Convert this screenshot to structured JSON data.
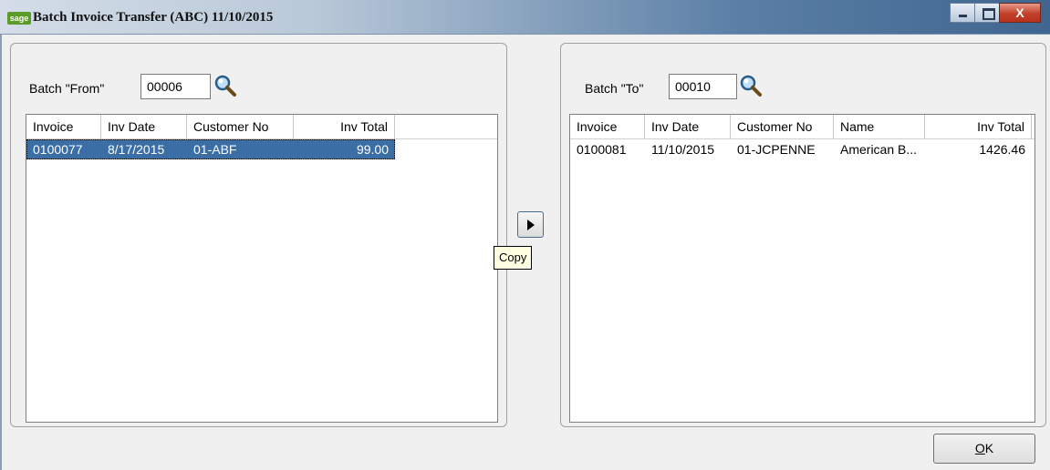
{
  "window": {
    "logo_text": "sage",
    "title": "Batch Invoice Transfer (ABC) 11/10/2015",
    "close_glyph": "X"
  },
  "left_panel": {
    "batch_label": "Batch \"From\"",
    "batch_value": "00006",
    "lookup_icon": "magnifier-icon",
    "columns": [
      "Invoice",
      "Inv Date",
      "Customer No",
      "Inv Total"
    ],
    "rows": [
      {
        "invoice": "0100077",
        "inv_date": "8/17/2015",
        "customer_no": "01-ABF",
        "inv_total": "99.00",
        "selected": true
      }
    ]
  },
  "right_panel": {
    "batch_label": "Batch \"To\"",
    "batch_value": "00010",
    "lookup_icon": "magnifier-icon",
    "columns": [
      "Invoice",
      "Inv Date",
      "Customer No",
      "Name",
      "Inv Total"
    ],
    "rows": [
      {
        "invoice": "0100081",
        "inv_date": "11/10/2015",
        "customer_no": "01-JCPENNE",
        "name": "American B...",
        "inv_total": "1426.46",
        "selected": false
      }
    ]
  },
  "copy": {
    "icon": "arrow-right-icon",
    "tooltip": "Copy"
  },
  "ok_button": {
    "mnemonic": "O",
    "rest": "K"
  },
  "colors": {
    "selection": "#3a6ea5",
    "tooltip_bg": "#ffffe1",
    "logo": "#5a9b2a"
  }
}
